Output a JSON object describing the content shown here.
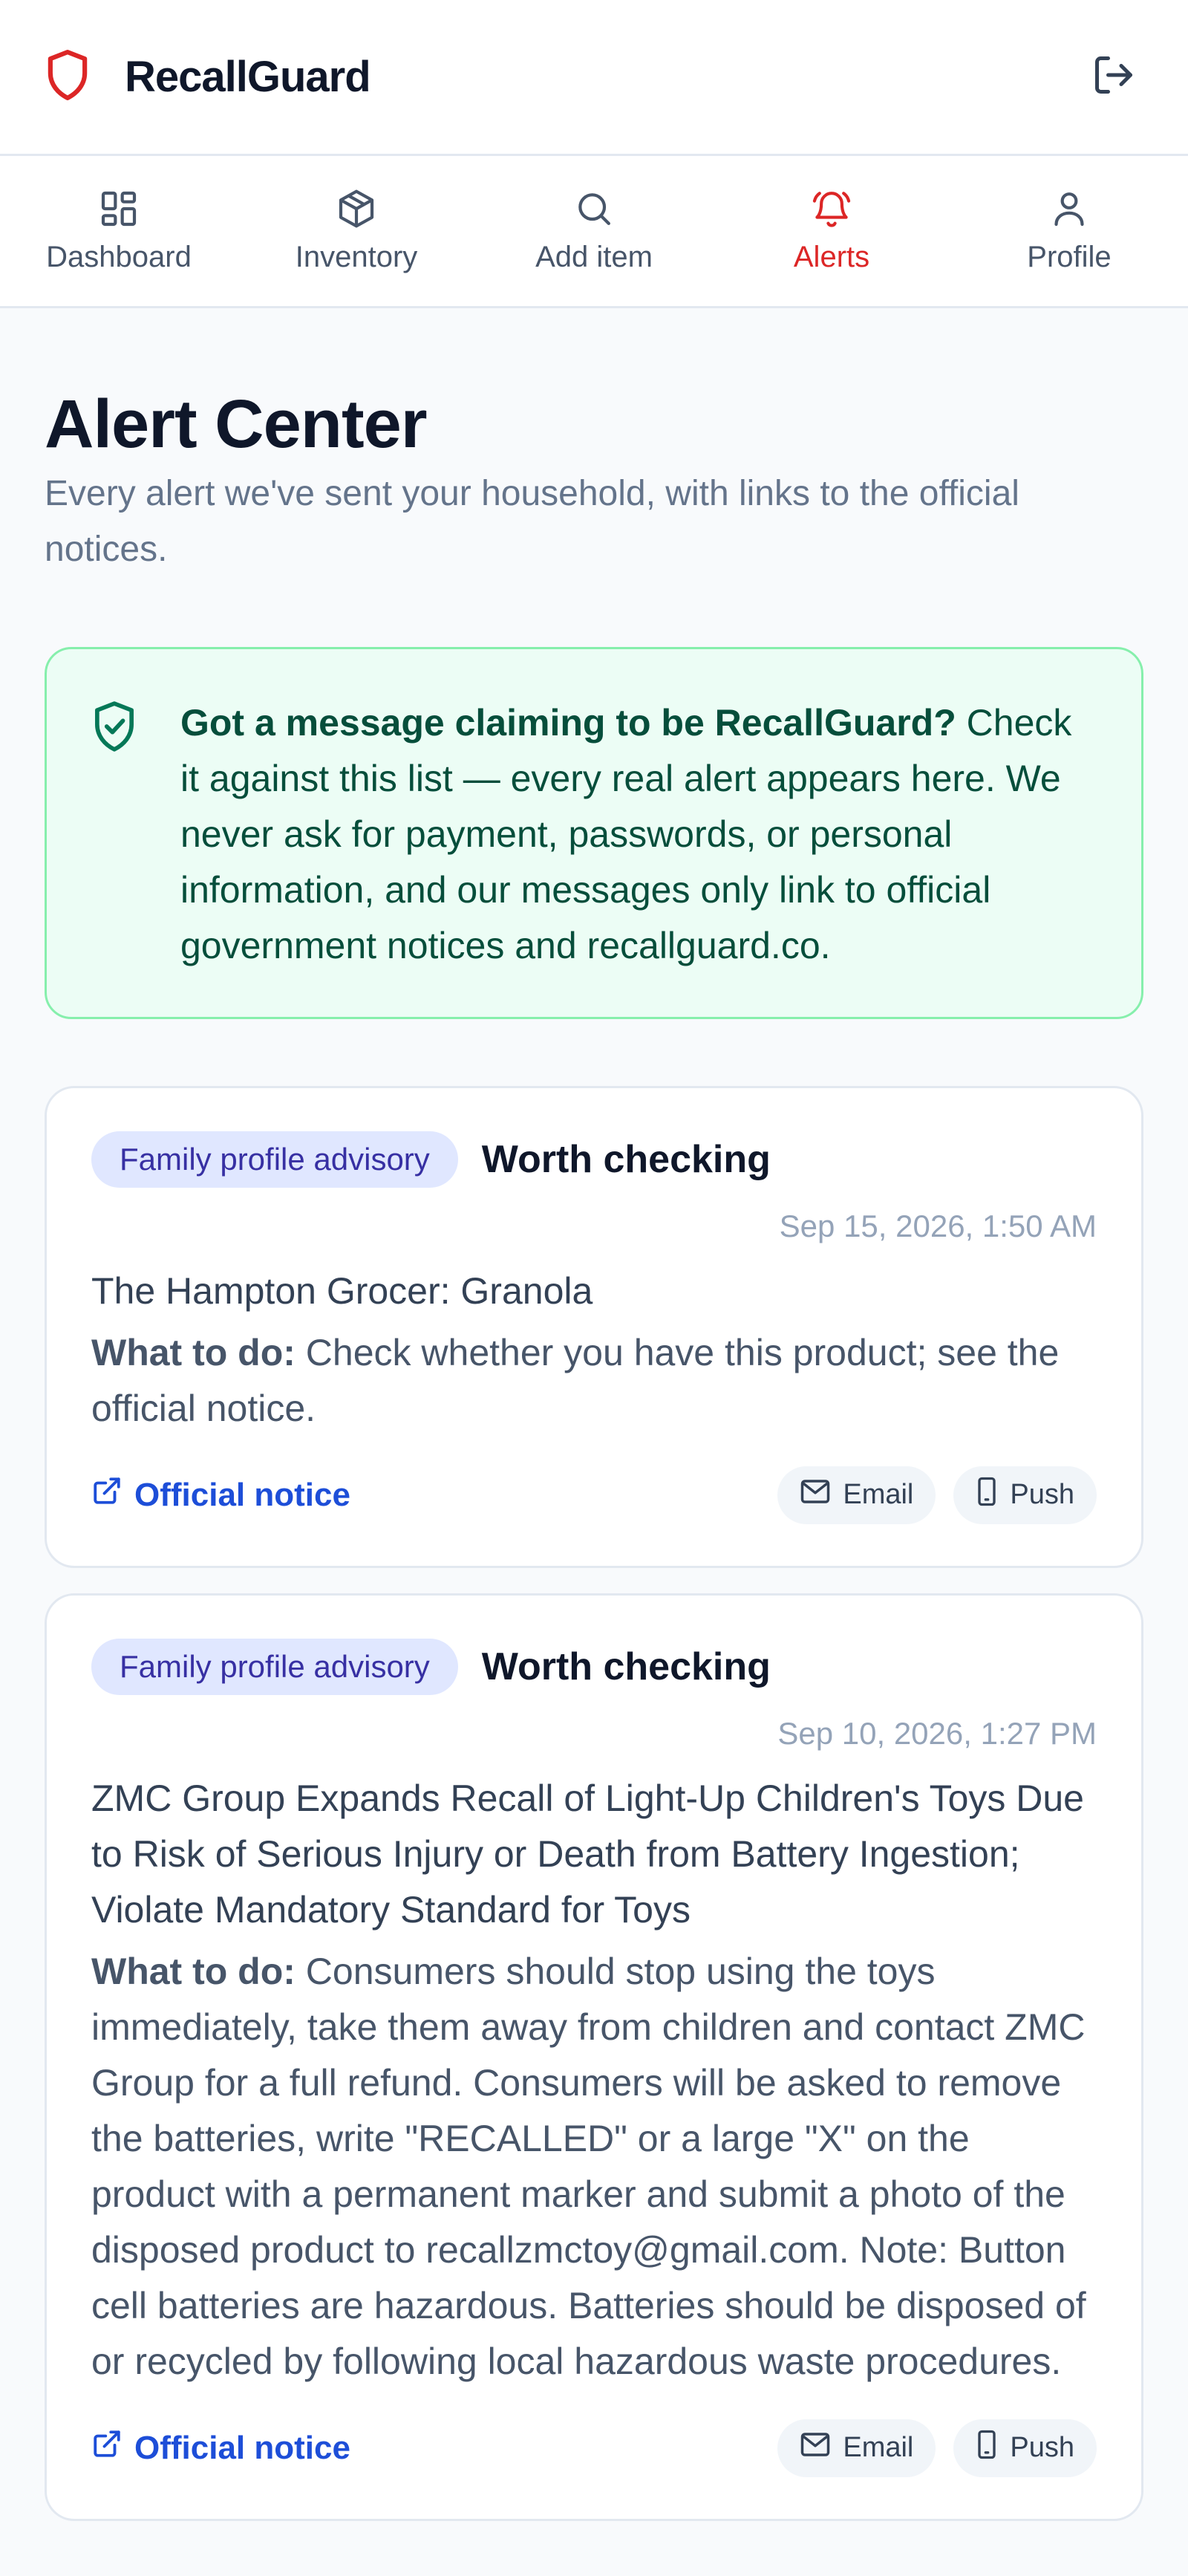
{
  "app": {
    "name": "RecallGuard",
    "brand_color": "#dc2626"
  },
  "header": {
    "logout_icon": "logout-icon"
  },
  "nav": {
    "tabs": [
      {
        "label": "Dashboard",
        "icon": "dashboard-icon",
        "active": false
      },
      {
        "label": "Inventory",
        "icon": "box-icon",
        "active": false
      },
      {
        "label": "Add item",
        "icon": "search-icon",
        "active": false
      },
      {
        "label": "Alerts",
        "icon": "bell-icon",
        "active": true
      },
      {
        "label": "Profile",
        "icon": "user-icon",
        "active": false
      }
    ]
  },
  "page": {
    "title": "Alert Center",
    "subtitle": "Every alert we've sent your household, with links to the official notices."
  },
  "notice": {
    "bold": "Got a message claiming to be RecallGuard?",
    "text": " Check it against this list — every real alert appears here. We never ask for payment, passwords, or personal information, and our messages only link to official government notices and recallguard.co."
  },
  "alerts": [
    {
      "tag": "Family profile advisory",
      "severity": "Worth checking",
      "date": "Sep 15, 2026, 1:50 AM",
      "title": "The Hampton Grocer: Granola",
      "action_label": "What to do:",
      "action_text": " Check whether you have this product; see the official notice.",
      "link": "Official notice",
      "channels": [
        "Email",
        "Push"
      ]
    },
    {
      "tag": "Family profile advisory",
      "severity": "Worth checking",
      "date": "Sep 10, 2026, 1:27 PM",
      "title": "ZMC Group Expands Recall of Light-Up Children's Toys Due to Risk of Serious Injury or Death from Battery Ingestion; Violate Mandatory Standard for Toys",
      "action_label": "What to do:",
      "action_text": " Consumers should stop using the toys immediately, take them away from children and contact ZMC Group for a full refund. Consumers will be asked to remove the batteries, write \"RECALLED\" or a large \"X\" on the product with a permanent marker and submit a photo of the disposed product to recallzmctoy@gmail.com. Note: Button cell batteries are hazardous. Batteries should be disposed of or recycled by following local hazardous waste procedures.",
      "link": "Official notice",
      "channels": [
        "Email",
        "Push"
      ]
    }
  ]
}
